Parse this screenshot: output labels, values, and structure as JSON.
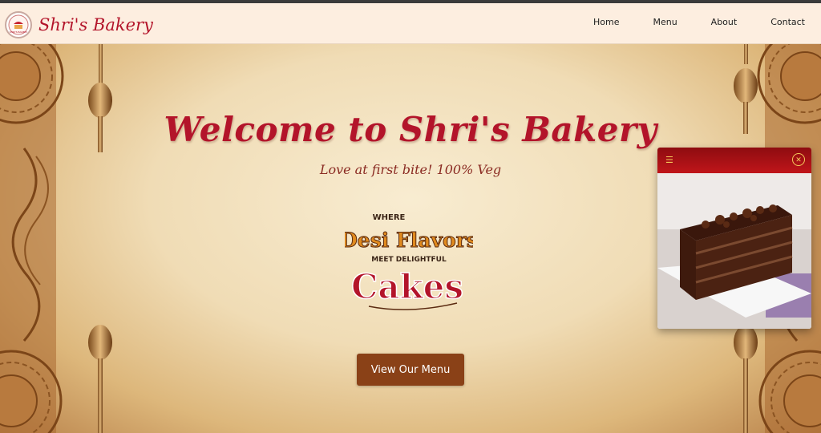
{
  "brand": {
    "name": "Shri's Bakery",
    "logo_text": "SHRI'S BAKERY"
  },
  "nav": {
    "items": [
      "Home",
      "Menu",
      "About",
      "Contact"
    ]
  },
  "hero": {
    "title": "Welcome to Shri's Bakery",
    "tagline": "Love at first bite! 100% Veg",
    "badge": {
      "line1": "WHERE",
      "line2": "Desi Flavors",
      "line3": "MEET DELIGHTFUL",
      "line4": "Cakes"
    },
    "cta": "View Our Menu"
  },
  "popup": {
    "menu_icon": "hamburger-icon",
    "close_icon": "close-icon",
    "image": "chocolate-cake"
  },
  "colors": {
    "brand_red": "#b3142a",
    "cta_brown": "#8a4117",
    "header_bg": "#fdeee0",
    "popup_bar": "#a80f14"
  }
}
